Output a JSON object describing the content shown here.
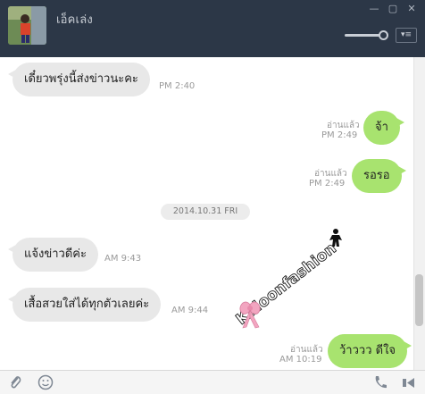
{
  "header": {
    "title": "เอ็คเล่ง",
    "window_controls": [
      "minimize-icon",
      "maximize-icon",
      "close-icon"
    ]
  },
  "messages": [
    {
      "side": "in",
      "text": "เดี๋ยวพรุ่งนี้ส่งข่าวนะคะ",
      "time": "PM 2:40"
    },
    {
      "side": "out",
      "text": "จ้า",
      "read": "อ่านแล้ว",
      "time": "PM 2:49"
    },
    {
      "side": "out",
      "text": "รอรอ",
      "read": "อ่านแล้ว",
      "time": "PM 2:49"
    },
    {
      "side": "in",
      "text": "แจ้งข่าวดีค่ะ",
      "time": "AM 9:43"
    },
    {
      "side": "in",
      "text": "เสื้อสวยใส่ได้ทุกตัวเลยค่ะ",
      "time": "AM 9:44"
    },
    {
      "side": "out",
      "text": "ว้าววว ดีใจ",
      "read": "อ่านแล้ว",
      "time": "AM 10:19"
    }
  ],
  "date_separator": "2014.10.31 FRI",
  "watermark": {
    "text": "Kaloonfashion"
  },
  "toolbar": {
    "icons": [
      "attach-icon",
      "emoticon-icon",
      "call-icon",
      "video-call-icon"
    ]
  },
  "colors": {
    "header_bg": "#2c3747",
    "outgoing_bubble": "#a8e36f",
    "incoming_bubble": "#e8e8e8"
  }
}
